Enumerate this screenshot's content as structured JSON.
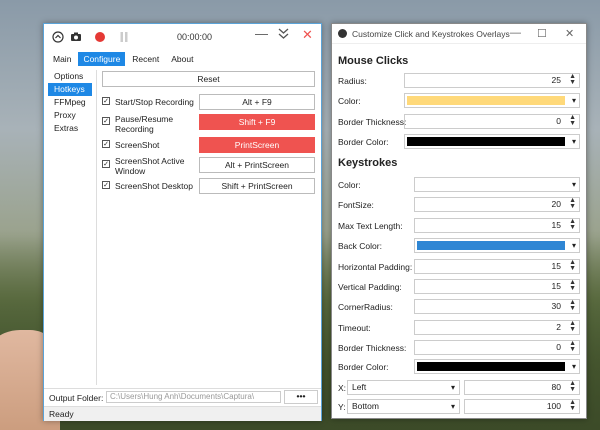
{
  "captura": {
    "timer": "00:00:00",
    "tabs": [
      "Main",
      "Configure",
      "Recent",
      "About"
    ],
    "sidebar": [
      "Options",
      "Hotkeys",
      "FFMpeg",
      "Proxy",
      "Extras"
    ],
    "reset_label": "Reset",
    "hotkeys": [
      {
        "label": "Start/Stop Recording",
        "key": "Alt + F9",
        "checked": true,
        "alert": false
      },
      {
        "label": "Pause/Resume Recording",
        "key": "Shift + F9",
        "checked": true,
        "alert": true
      },
      {
        "label": "ScreenShot",
        "key": "PrintScreen",
        "checked": true,
        "alert": true
      },
      {
        "label": "ScreenShot Active Window",
        "key": "Alt + PrintScreen",
        "checked": true,
        "alert": false
      },
      {
        "label": "ScreenShot Desktop",
        "key": "Shift + PrintScreen",
        "checked": true,
        "alert": false
      }
    ],
    "output_folder_label": "Output Folder:",
    "output_folder_value": "C:\\Users\\Hung Anh\\Documents\\Captura\\",
    "browse_label": "•••",
    "status": "Ready",
    "colors": {
      "accent": "#1e88e5",
      "alert": "#ef5350",
      "record": "#e53935"
    }
  },
  "overlay": {
    "title": "Customize Click and Keystrokes Overlays",
    "mouse_heading": "Mouse Clicks",
    "mouse": {
      "radius_label": "Radius:",
      "radius": "25",
      "color_label": "Color:",
      "color": "#ffd97a",
      "border_thickness_label": "Border Thickness:",
      "border_thickness": "0",
      "border_color_label": "Border Color:",
      "border_color": "#000000"
    },
    "keys_heading": "Keystrokes",
    "keys": {
      "color_label": "Color:",
      "color": "#ffffff",
      "fontsize_label": "FontSize:",
      "fontsize": "20",
      "max_text_label": "Max Text Length:",
      "max_text": "15",
      "back_color_label": "Back Color:",
      "back_color": "#2f86d4",
      "hpad_label": "Horizontal Padding:",
      "hpad": "15",
      "vpad_label": "Vertical Padding:",
      "vpad": "15",
      "corner_label": "CornerRadius:",
      "corner": "30",
      "timeout_label": "Timeout:",
      "timeout": "2",
      "border_thickness_label": "Border Thickness:",
      "border_thickness": "0",
      "border_color_label": "Border Color:",
      "border_color": "#000000",
      "x_label": "X:",
      "x_align": "Left",
      "x_value": "80",
      "y_label": "Y:",
      "y_align": "Bottom",
      "y_value": "100"
    }
  }
}
